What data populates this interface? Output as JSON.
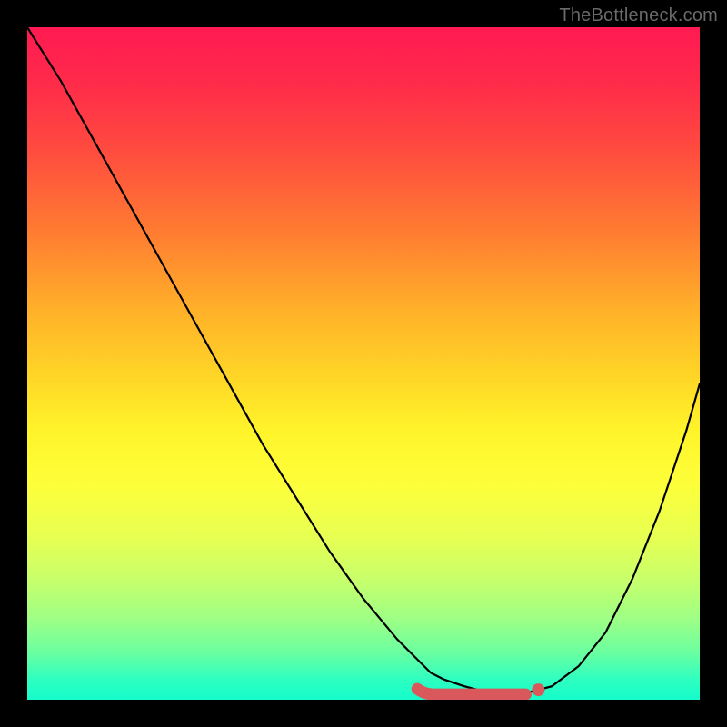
{
  "watermark": "TheBottleneck.com",
  "colors": {
    "curve": "#000000",
    "highlight": "#d9585b",
    "background": "#000000"
  },
  "chart_data": {
    "type": "line",
    "title": "",
    "xlabel": "",
    "ylabel": "",
    "xlim": [
      0,
      100
    ],
    "ylim": [
      0,
      100
    ],
    "series": [
      {
        "name": "bottleneck-curve",
        "x": [
          0,
          5,
          10,
          15,
          20,
          25,
          30,
          35,
          40,
          45,
          50,
          55,
          58,
          60,
          62,
          65,
          68,
          70,
          72,
          75,
          78,
          82,
          86,
          90,
          94,
          98,
          100
        ],
        "y": [
          100,
          92,
          83,
          74,
          65,
          56,
          47,
          38,
          30,
          22,
          15,
          9,
          6,
          4,
          3,
          2,
          1.2,
          1,
          1,
          1.2,
          2,
          5,
          10,
          18,
          28,
          40,
          47
        ]
      }
    ],
    "highlight_range": {
      "name": "optimal-zone",
      "x_start": 58,
      "x_end": 76,
      "y": 1.2
    },
    "gradient_stops": [
      {
        "pos": 0,
        "color": "#ff1a52"
      },
      {
        "pos": 30,
        "color": "#ff7a32"
      },
      {
        "pos": 60,
        "color": "#fff42a"
      },
      {
        "pos": 85,
        "color": "#9eff85"
      },
      {
        "pos": 100,
        "color": "#15fccb"
      }
    ]
  }
}
